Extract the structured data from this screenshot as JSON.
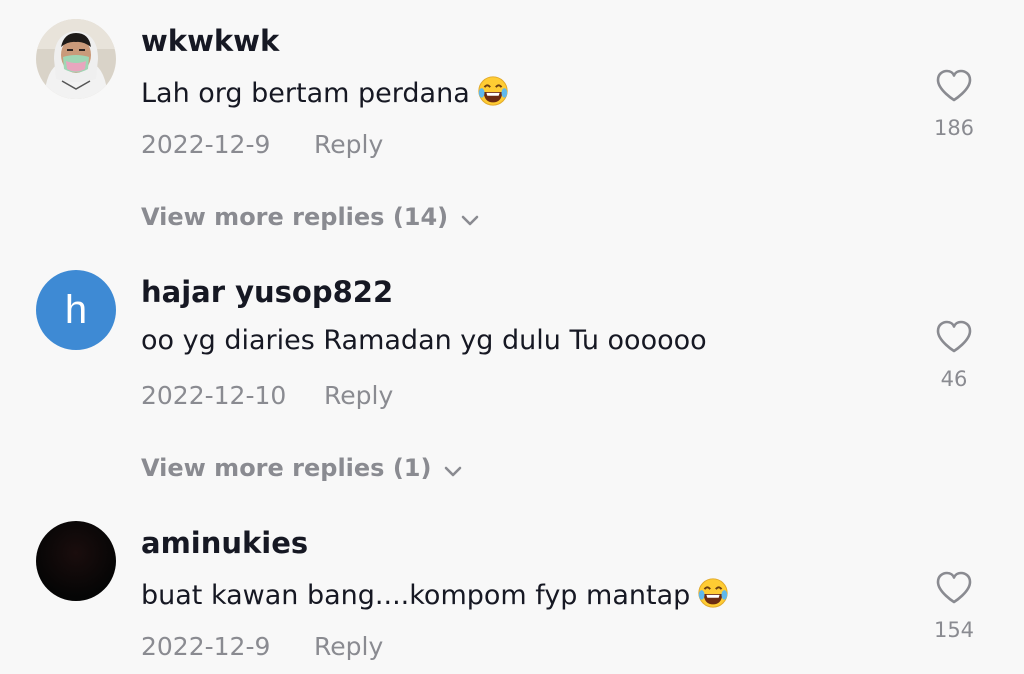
{
  "comments": [
    {
      "username": "wkwkwk",
      "text": "Lah org bertam perdana",
      "text_emoji": "laughing-tears-emoji",
      "date": "2022-12-9",
      "reply_label": "Reply",
      "likes": "186",
      "view_more": "View more replies (14)",
      "avatar": "photo"
    },
    {
      "username": "hajar yusop822",
      "text": "oo yg diaries Ramadan yg dulu Tu oooooo",
      "date": "2022-12-10",
      "reply_label": "Reply",
      "likes": "46",
      "view_more": "View more replies (1)",
      "avatar_letter": "h",
      "avatar_color": "#3e8ad4"
    },
    {
      "username": "aminukies",
      "text": "buat kawan bang....kompom fyp mantap",
      "text_emoji": "laughing-tears-emoji",
      "date": "2022-12-9",
      "reply_label": "Reply",
      "likes": "154",
      "avatar": "dark"
    }
  ],
  "colors": {
    "background": "#f8f8f8",
    "primary_text": "#161823",
    "secondary_text": "#8a8b91",
    "avatar_blue": "#3e8ad4"
  }
}
